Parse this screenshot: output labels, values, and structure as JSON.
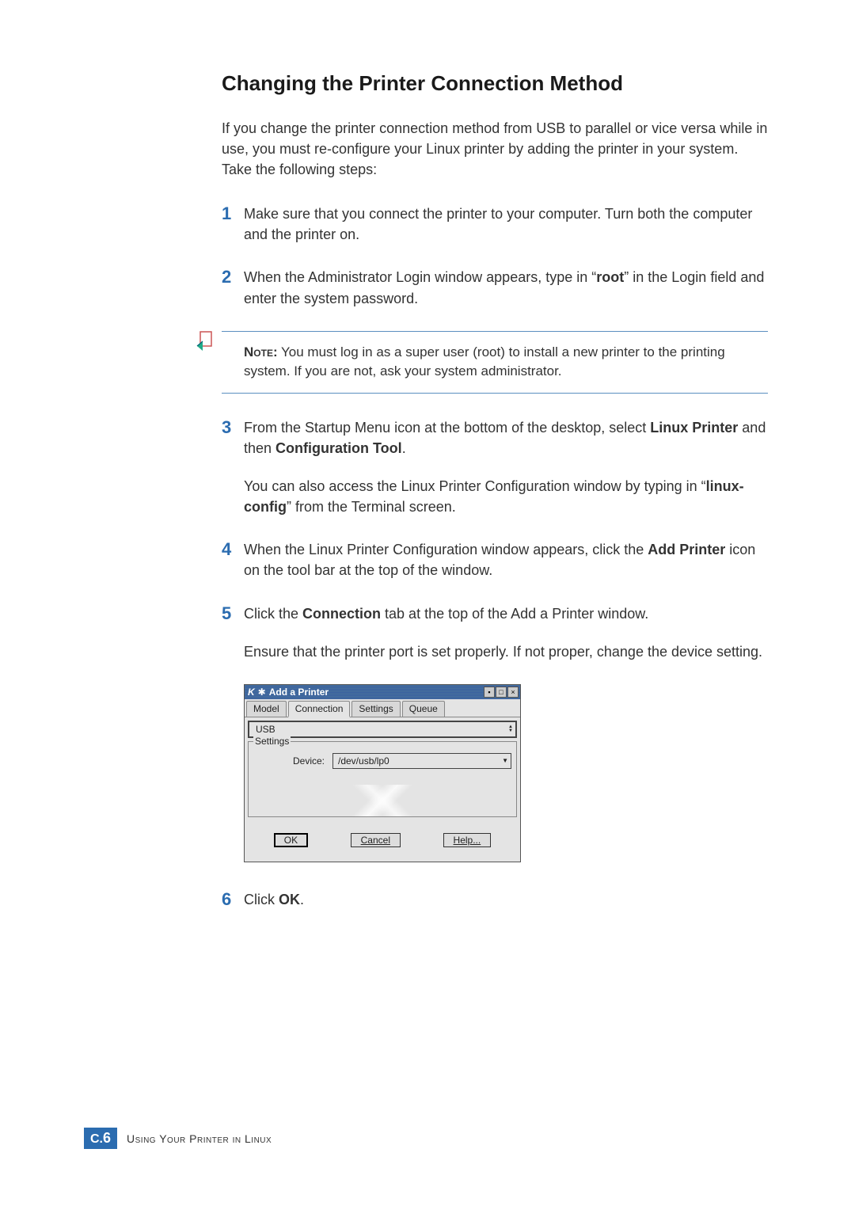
{
  "title": "Changing the Printer Connection Method",
  "intro": "If you change the printer connection method from USB to parallel or vice versa while in use, you must re-configure your Linux printer by adding the printer in your system. Take the following steps:",
  "step1": "Make sure that you connect the printer to your computer. Turn both the computer and the printer on.",
  "step2_pre": "When the Administrator Login window appears, type in “",
  "step2_bold": "root",
  "step2_post": "” in the Login field and enter the system password.",
  "note_label": "Note:",
  "note_body": " You must log in as a super user (root) to install a new printer to the printing system. If you are not, ask your system administrator.",
  "step3_p1_a": "From the Startup Menu icon at the bottom of the desktop, select ",
  "step3_p1_b": "Linux Printer",
  "step3_p1_c": " and then ",
  "step3_p1_d": "Configuration Tool",
  "step3_p1_e": ".",
  "step3_p2_a": "You can also access the Linux Printer Configuration window by typing in “",
  "step3_p2_b": "linux-config",
  "step3_p2_c": "” from the Terminal screen.",
  "step4_a": "When the Linux Printer Configuration window appears, click the ",
  "step4_b": "Add Printer",
  "step4_c": " icon on the tool bar at the top of the window.",
  "step5_p1_a": "Click the ",
  "step5_p1_b": "Connection",
  "step5_p1_c": " tab at the top of the Add a Printer window.",
  "step5_p2": "Ensure that the printer port is set properly. If not proper, change the device setting.",
  "step6_a": "Click ",
  "step6_b": "OK",
  "step6_c": ".",
  "dialog": {
    "title": "Add a Printer",
    "tabs": {
      "model": "Model",
      "connection": "Connection",
      "settings": "Settings",
      "queue": "Queue"
    },
    "port": "USB",
    "fieldset_label": "Settings",
    "device_label": "Device:",
    "device_value": "/dev/usb/lp0",
    "ok": "OK",
    "cancel": "Cancel",
    "help": "Help..."
  },
  "footer": {
    "section": "C.",
    "page": "6",
    "text": "Using Your Printer in Linux"
  },
  "nums": {
    "n1": "1",
    "n2": "2",
    "n3": "3",
    "n4": "4",
    "n5": "5",
    "n6": "6"
  }
}
